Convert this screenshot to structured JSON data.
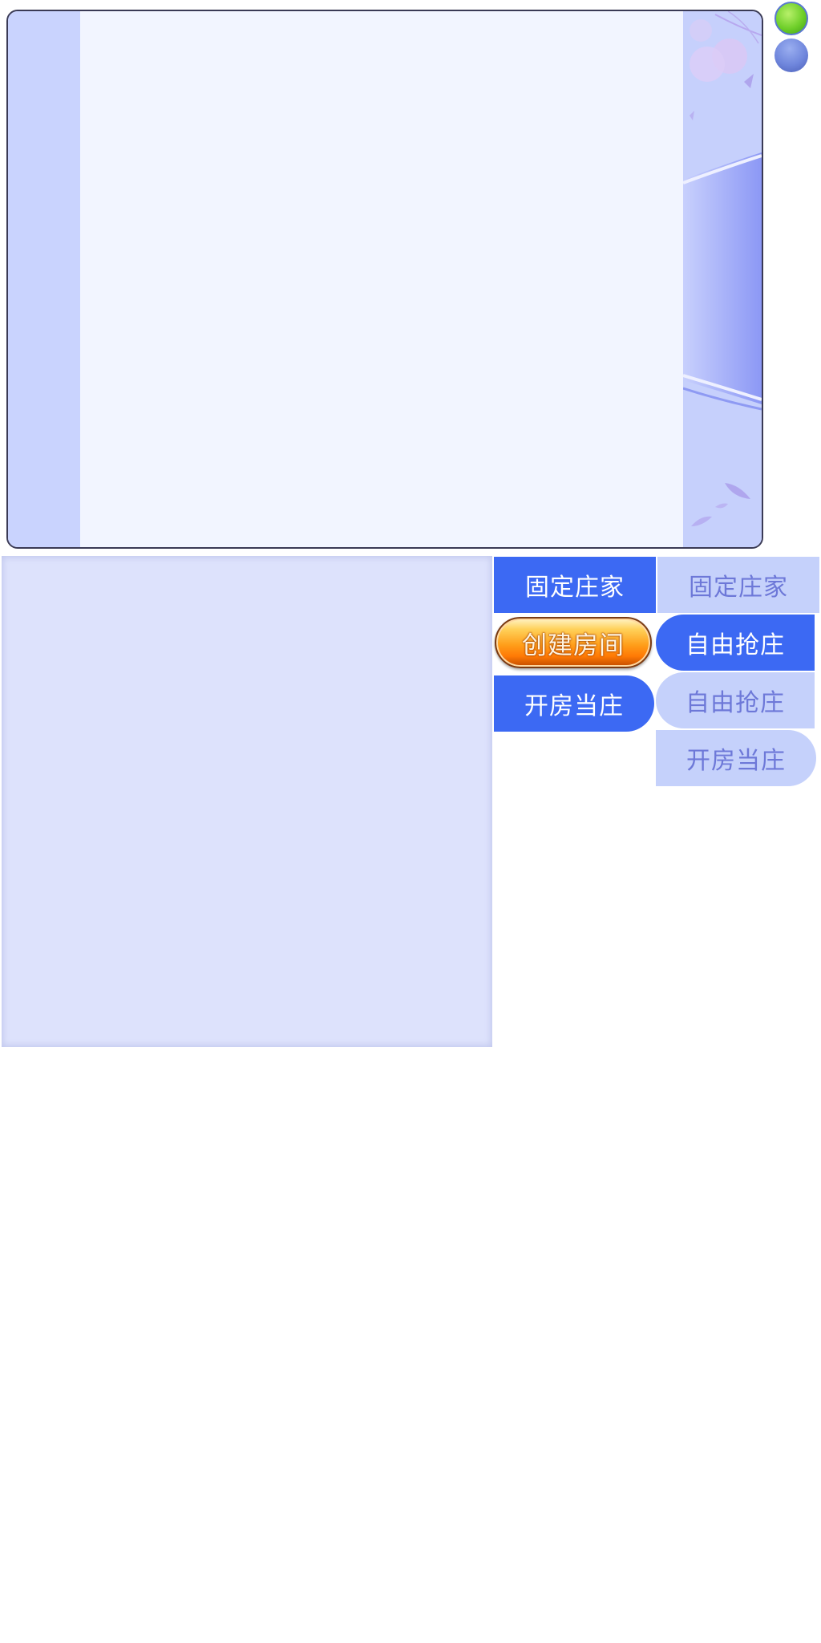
{
  "buttons": {
    "fixed_banker_active": "固定庄家",
    "fixed_banker_inactive": "固定庄家",
    "create_room": "创建房间",
    "free_grab_active": "自由抢庄",
    "free_grab_inactive": "自由抢庄",
    "open_room_banker_active": "开房当庄",
    "open_room_banker_inactive": "开房当庄"
  },
  "colors": {
    "active_tab": "#3c69f3",
    "inactive_tab": "#c5d1fb",
    "inactive_text": "#6d78d8",
    "panel_background": "#f2f5ff",
    "lower_pane": "#dde2fc",
    "create_button": "#ff9e1a"
  }
}
